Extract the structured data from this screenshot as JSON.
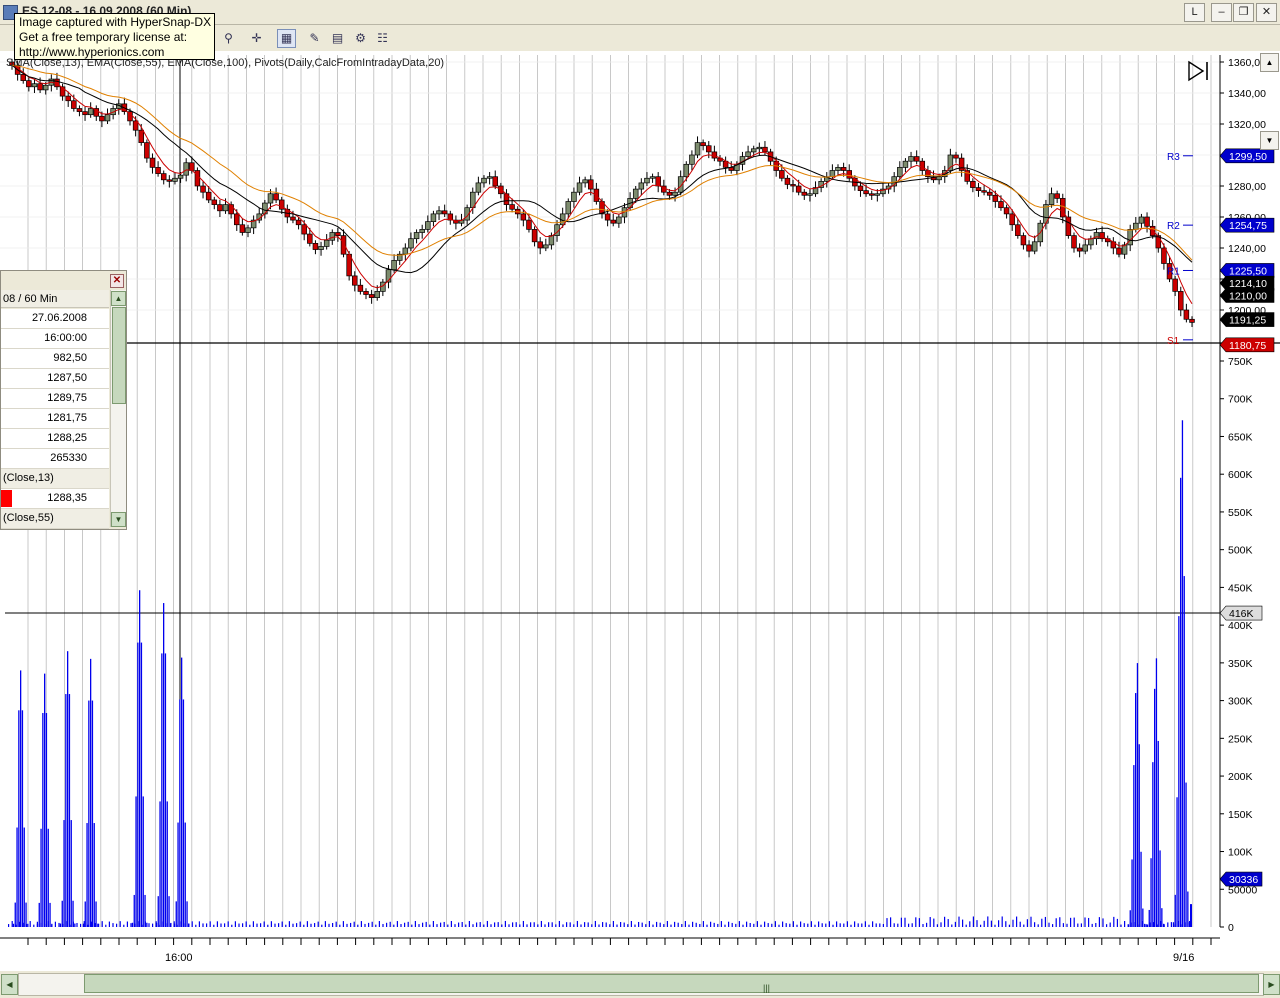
{
  "window": {
    "title": "ES 12-08 - 16.09.2008 (60 Min)",
    "layout_btn": "L"
  },
  "tooltip": {
    "lines": [
      "Image captured with HyperSnap-DX",
      "Get a free temporary license at:",
      "http://www.hyperionics.com"
    ]
  },
  "toolbar": {
    "icons": [
      "zoom-icon",
      "crosshair-icon",
      "properties-icon",
      "pencil-icon",
      "chart-style-icon",
      "settings-icon",
      "data-box-icon"
    ]
  },
  "indicator_label": "SMA(Close,13), EMA(Close,55), EMA(Close,100), Pivots(Daily,CalcFromIntradayData,20)",
  "data_window": {
    "header": "08 / 60 Min",
    "rows": [
      "27.06.2008",
      "16:00:00",
      "982,50",
      "1287,50",
      "1289,75",
      "1281,75",
      "1288,25",
      "265330"
    ],
    "sma_label": "(Close,13)",
    "sma_value": "1288,35",
    "ema_label": "(Close,55)"
  },
  "chart_data": [
    {
      "type": "candlestick",
      "title": "",
      "y_ticks": [
        "1360,0",
        "1340,00",
        "1320,00",
        "1300,00",
        "1280,00",
        "1260,00",
        "1240,00",
        "1220,00",
        "1200,00"
      ],
      "ylim": [
        1177,
        1363
      ],
      "price_markers": [
        {
          "label": "1299,50",
          "value": 1299.5,
          "color": "#0000cc"
        },
        {
          "label": "1254,75",
          "value": 1254.75,
          "color": "#0000cc"
        },
        {
          "label": "1225,50",
          "value": 1225.5,
          "color": "#0000cc"
        },
        {
          "label": "1214,10",
          "value": 1214.1,
          "color": "#000000"
        },
        {
          "label": "1210,00",
          "value": 1210.0,
          "color": "#000000"
        },
        {
          "label": "1191,25",
          "value": 1191.25,
          "color": "#000000"
        },
        {
          "label": "1180,75",
          "value": 1180.75,
          "color": "#cc0000"
        }
      ],
      "pivots": [
        {
          "label": "R3",
          "value": 1299.5
        },
        {
          "label": "R2",
          "value": 1254.75
        },
        {
          "label": "R1",
          "value": 1225.5
        },
        {
          "label": "S1",
          "value": 1180.75
        }
      ],
      "series": [
        {
          "name": "SMA(Close,13)",
          "color": "#000000"
        },
        {
          "name": "EMA(Close,55)",
          "color": "#e08000"
        },
        {
          "name": "EMA(Close,100)",
          "color": "#cc0000"
        }
      ],
      "close": [
        1358,
        1352,
        1348,
        1344,
        1346,
        1342,
        1345,
        1349,
        1344,
        1338,
        1335,
        1330,
        1328,
        1326,
        1330,
        1325,
        1322,
        1326,
        1330,
        1333,
        1328,
        1322,
        1316,
        1308,
        1298,
        1292,
        1288,
        1284,
        1283,
        1285,
        1287,
        1295,
        1290,
        1280,
        1276,
        1271,
        1268,
        1264,
        1268,
        1262,
        1255,
        1250,
        1253,
        1258,
        1262,
        1269,
        1275,
        1271,
        1265,
        1260,
        1258,
        1255,
        1249,
        1243,
        1239,
        1241,
        1245,
        1250,
        1248,
        1236,
        1222,
        1216,
        1212,
        1210,
        1208,
        1212,
        1218,
        1226,
        1232,
        1236,
        1240,
        1246,
        1250,
        1252,
        1257,
        1262,
        1264,
        1262,
        1258,
        1256,
        1258,
        1266,
        1276,
        1282,
        1285,
        1286,
        1280,
        1275,
        1268,
        1265,
        1262,
        1258,
        1252,
        1244,
        1240,
        1242,
        1248,
        1255,
        1262,
        1270,
        1276,
        1282,
        1284,
        1278,
        1270,
        1262,
        1258,
        1256,
        1260,
        1266,
        1272,
        1278,
        1282,
        1285,
        1286,
        1280,
        1276,
        1274,
        1276,
        1286,
        1294,
        1300,
        1308,
        1306,
        1302,
        1298,
        1296,
        1292,
        1290,
        1294,
        1299,
        1302,
        1304,
        1305,
        1302,
        1296,
        1290,
        1285,
        1281,
        1280,
        1276,
        1274,
        1275,
        1279,
        1283,
        1286,
        1290,
        1292,
        1290,
        1285,
        1280,
        1277,
        1275,
        1274,
        1275,
        1278,
        1280,
        1286,
        1292,
        1296,
        1299,
        1296,
        1290,
        1286,
        1284,
        1286,
        1290,
        1300,
        1298,
        1290,
        1283,
        1279,
        1277,
        1276,
        1274,
        1270,
        1266,
        1262,
        1255,
        1248,
        1242,
        1238,
        1244,
        1256,
        1268,
        1275,
        1272,
        1260,
        1248,
        1240,
        1238,
        1242,
        1246,
        1250,
        1246,
        1244,
        1240,
        1236,
        1242,
        1252,
        1256,
        1260,
        1254,
        1248,
        1240,
        1230,
        1220,
        1212,
        1200,
        1194,
        1192
      ]
    },
    {
      "type": "bar",
      "title": "",
      "y_ticks": [
        "750K",
        "700K",
        "650K",
        "600K",
        "550K",
        "500K",
        "450K",
        "400K",
        "350K",
        "300K",
        "250K",
        "200K",
        "150K",
        "100K",
        "50000",
        "0"
      ],
      "ylim": [
        0,
        780000
      ],
      "current_marker": {
        "label": "416K",
        "value": 416000
      },
      "last_marker": {
        "label": "30336",
        "value": 30336
      },
      "volume_peaks": [
        400000,
        395000,
        430000,
        418000,
        525000,
        505000,
        420000,
        388000,
        395000,
        745000
      ]
    }
  ],
  "time_axis": {
    "labels": [
      "16:00",
      "9/16"
    ]
  }
}
